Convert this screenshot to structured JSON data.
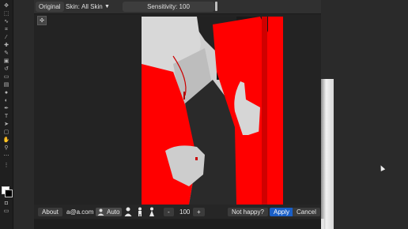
{
  "topbar": {
    "original_label": "Original",
    "skin_label": "Skin:",
    "skin_select_value": "All Skin",
    "skin_dropdown_icon": "triangle-down-icon",
    "sensitivity_label": "Sensitivity: 100"
  },
  "bottombar": {
    "about_label": "About",
    "email": "a@a.com",
    "auto_label": "Auto",
    "minus_label": "-",
    "value": "100",
    "plus_label": "+",
    "not_happy_label": "Not happy?",
    "apply_label": "Apply",
    "cancel_label": "Cancel"
  },
  "colors": {
    "accent_blue": "#1a5fc7",
    "highlight_red": "#ff0000"
  }
}
